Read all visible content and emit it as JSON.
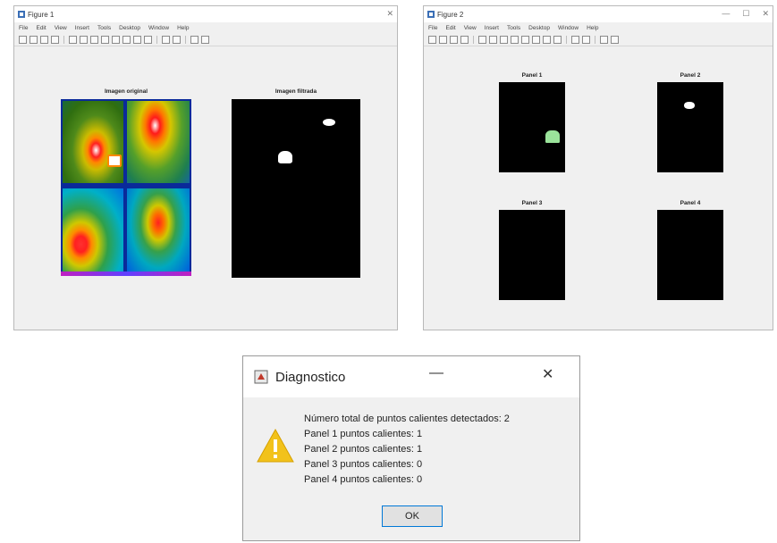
{
  "figure1": {
    "title": "Figure 1",
    "menu": [
      "File",
      "Edit",
      "View",
      "Insert",
      "Tools",
      "Desktop",
      "Window",
      "Help"
    ],
    "axes_left_title": "Imagen original",
    "axes_right_title": "Imagen filtrada"
  },
  "figure2": {
    "title": "Figure 2",
    "menu": [
      "File",
      "Edit",
      "View",
      "Insert",
      "Tools",
      "Desktop",
      "Window",
      "Help"
    ],
    "panels": [
      "Panel 1",
      "Panel 2",
      "Panel 3",
      "Panel 4"
    ]
  },
  "dialog": {
    "title": "Diagnostico",
    "lines": [
      "Número total de puntos calientes detectados: 2",
      "Panel 1 puntos calientes: 1",
      "Panel 2 puntos calientes: 1",
      "Panel 3 puntos calientes: 0",
      "Panel 4 puntos calientes: 0"
    ],
    "ok_label": "OK",
    "close_symbol": "✕",
    "minimize_symbol": "—"
  },
  "colors": {
    "hotspot_green": "#9be39b",
    "warning": "#f2c21b"
  }
}
